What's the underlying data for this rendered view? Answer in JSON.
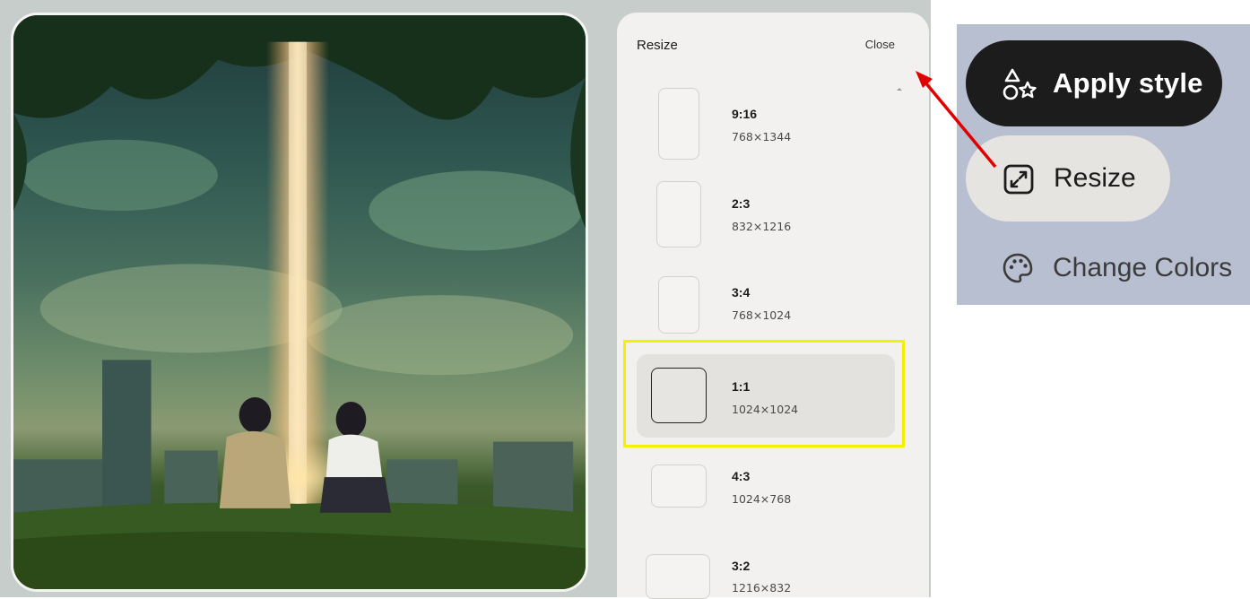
{
  "panel": {
    "title": "Resize",
    "close_label": "Close",
    "options": [
      {
        "ratio": "9:16",
        "dims": "768×1344",
        "selected": false
      },
      {
        "ratio": "2:3",
        "dims": "832×1216",
        "selected": false
      },
      {
        "ratio": "3:4",
        "dims": "768×1024",
        "selected": false
      },
      {
        "ratio": "1:1",
        "dims": "1024×1024",
        "selected": true
      },
      {
        "ratio": "4:3",
        "dims": "1024×768",
        "selected": false
      },
      {
        "ratio": "3:2",
        "dims": "1216×832",
        "selected": false
      }
    ]
  },
  "toolbar_inset": {
    "apply_style_label": "Apply style",
    "apply_style_icon": "shapes-icon",
    "resize_label": "Resize",
    "resize_icon": "resize-expand-icon",
    "change_colors_label": "Change Colors",
    "change_colors_icon": "palette-icon"
  },
  "colors": {
    "highlight": "#f5f000",
    "annotation_arrow": "#e00000",
    "apply_style_bg": "#1c1c1c",
    "resize_bg": "#e6e4e0",
    "inset_bg": "#b8bfd0"
  }
}
